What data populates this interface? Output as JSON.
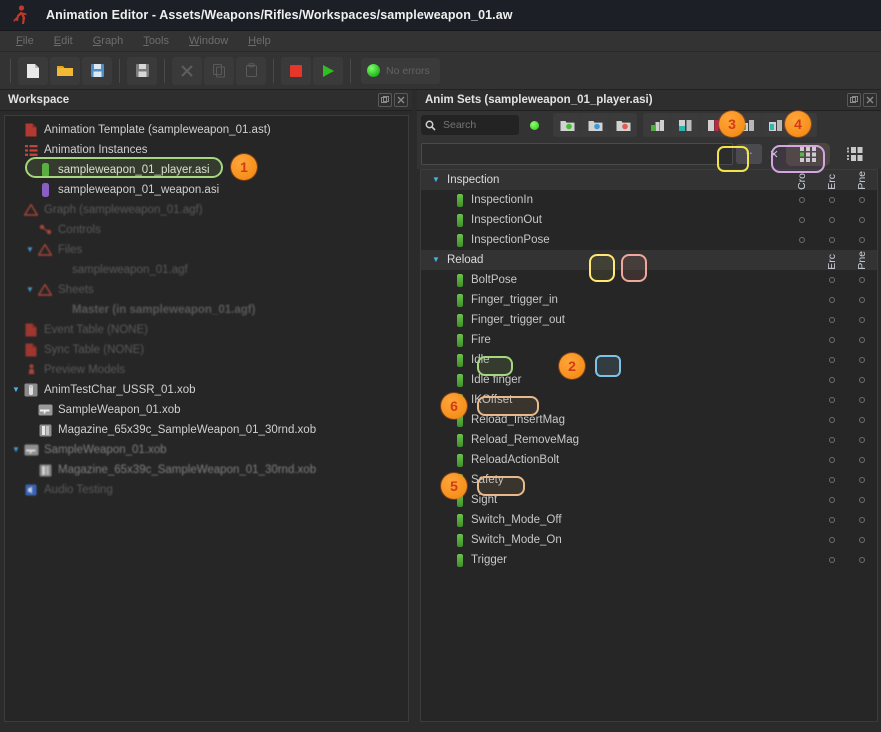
{
  "window": {
    "title": "Animation Editor - Assets/Weapons/Rifles/Workspaces/sampleweapon_01.aw",
    "icon": "running-man-icon"
  },
  "menubar": [
    {
      "label": "File",
      "mnemonic": "F"
    },
    {
      "label": "Edit",
      "mnemonic": "E"
    },
    {
      "label": "Graph",
      "mnemonic": "G"
    },
    {
      "label": "Tools",
      "mnemonic": "T"
    },
    {
      "label": "Window",
      "mnemonic": "W"
    },
    {
      "label": "Help",
      "mnemonic": "H"
    }
  ],
  "toolbar": {
    "buttons": [
      {
        "name": "new-file-icon",
        "tip": "New"
      },
      {
        "name": "open-folder-icon",
        "tip": "Open"
      },
      {
        "name": "save-icon",
        "tip": "Save"
      },
      {
        "name": "save-as-icon",
        "tip": "Save As"
      },
      {
        "name": "cut-icon",
        "tip": "Cut"
      },
      {
        "name": "copy-icon",
        "tip": "Copy"
      },
      {
        "name": "paste-icon",
        "tip": "Paste"
      },
      {
        "name": "stop-icon",
        "tip": "Stop"
      },
      {
        "name": "play-icon",
        "tip": "Play"
      }
    ],
    "status_label": "No errors",
    "status_color": "#33c024"
  },
  "workspace": {
    "panel_title": "Workspace",
    "items": [
      {
        "label": "Animation Template (sampleweapon_01.ast)",
        "indent": 0,
        "icon": "document-red-icon",
        "caret": "none",
        "state": "normal"
      },
      {
        "label": "Animation Instances",
        "indent": 0,
        "icon": "list-red-icon",
        "caret": "none",
        "state": "normal"
      },
      {
        "label": "sampleweapon_01_player.asi",
        "indent": 1,
        "icon": "green-bar-icon",
        "caret": "none",
        "state": "selected"
      },
      {
        "label": "sampleweapon_01_weapon.asi",
        "indent": 1,
        "icon": "purple-bar-icon",
        "caret": "none",
        "state": "normal"
      },
      {
        "label": "Graph (sampleweapon_01.agf)",
        "indent": 0,
        "icon": "graph-red-icon",
        "caret": "none",
        "state": "dim"
      },
      {
        "label": "Controls",
        "indent": 1,
        "icon": "controls-red-icon",
        "caret": "none",
        "state": "dim"
      },
      {
        "label": "Files",
        "indent": 1,
        "icon": "graph-red-icon",
        "caret": "open",
        "state": "dim"
      },
      {
        "label": "sampleweapon_01.agf",
        "indent": 2,
        "icon": "none",
        "caret": "none",
        "state": "dim"
      },
      {
        "label": "Sheets",
        "indent": 1,
        "icon": "graph-red-icon",
        "caret": "open",
        "state": "dim"
      },
      {
        "label": "Master (in sampleweapon_01.agf)",
        "indent": 2,
        "icon": "none",
        "caret": "none",
        "state": "dim-bold"
      },
      {
        "label": "Event Table (NONE)",
        "indent": 0,
        "icon": "document-red-icon",
        "caret": "none",
        "state": "dim"
      },
      {
        "label": "Sync Table (NONE)",
        "indent": 0,
        "icon": "document-red-icon",
        "caret": "none",
        "state": "dim"
      },
      {
        "label": "Preview Models",
        "indent": 0,
        "icon": "model-red-icon",
        "caret": "none",
        "state": "dim"
      },
      {
        "label": "AnimTestChar_USSR_01.xob",
        "indent": 0,
        "icon": "character-icon",
        "caret": "open",
        "state": "normal"
      },
      {
        "label": "SampleWeapon_01.xob",
        "indent": 1,
        "icon": "weapon-icon",
        "caret": "none",
        "state": "normal"
      },
      {
        "label": "Magazine_65x39c_SampleWeapon_01_30rnd.xob",
        "indent": 1,
        "icon": "magazine-icon",
        "caret": "none",
        "state": "normal"
      },
      {
        "label": "SampleWeapon_01.xob",
        "indent": 0,
        "icon": "weapon-icon",
        "caret": "open",
        "state": "dim2"
      },
      {
        "label": "Magazine_65x39c_SampleWeapon_01_30rnd.xob",
        "indent": 1,
        "icon": "magazine-icon",
        "caret": "none",
        "state": "dim2"
      },
      {
        "label": "Audio Testing",
        "indent": 0,
        "icon": "audio-blue-icon",
        "caret": "none",
        "state": "dim"
      }
    ]
  },
  "animsets": {
    "panel_title": "Anim Sets (sampleweapon_01_player.asi)",
    "search_placeholder": "Search",
    "search_value": "",
    "filter_value": "",
    "dots_label": "..",
    "close_label": "×",
    "columns": [
      "Cro",
      "Erc",
      "Pne"
    ],
    "tree": [
      {
        "label": "Inspection",
        "type": "group",
        "cells": 0,
        "headers": true
      },
      {
        "label": "InspectionIn",
        "type": "item",
        "cells": 3
      },
      {
        "label": "InspectionOut",
        "type": "item",
        "cells": 3
      },
      {
        "label": "InspectionPose",
        "type": "item",
        "cells": 3
      },
      {
        "label": "Reload",
        "type": "group",
        "cells": 0,
        "headers_partial": [
          "Erc",
          "Pne"
        ]
      },
      {
        "label": "BoltPose",
        "type": "item",
        "cells": 2
      },
      {
        "label": "Finger_trigger_in",
        "type": "item",
        "cells": 2
      },
      {
        "label": "Finger_trigger_out",
        "type": "item",
        "cells": 2
      },
      {
        "label": "Fire",
        "type": "item",
        "cells": 2
      },
      {
        "label": "Idle",
        "type": "item",
        "cells": 2
      },
      {
        "label": "Idle finger",
        "type": "item",
        "cells": 2
      },
      {
        "label": "IKOffset",
        "type": "item",
        "cells": 2
      },
      {
        "label": "Reload_InsertMag",
        "type": "item",
        "cells": 2
      },
      {
        "label": "Reload_RemoveMag",
        "type": "item",
        "cells": 2
      },
      {
        "label": "ReloadActionBolt",
        "type": "item",
        "cells": 2
      },
      {
        "label": "Safety",
        "type": "item",
        "cells": 2
      },
      {
        "label": "Sight",
        "type": "item",
        "cells": 2
      },
      {
        "label": "Switch_Mode_Off",
        "type": "item",
        "cells": 2
      },
      {
        "label": "Switch_Mode_On",
        "type": "item",
        "cells": 2
      },
      {
        "label": "Trigger",
        "type": "item",
        "cells": 2
      }
    ]
  },
  "annotations": {
    "badges": [
      {
        "number": "1",
        "target": "sampleweapon_01_player.asi"
      },
      {
        "number": "2",
        "target": "Idle-Cro-cell"
      },
      {
        "number": "3",
        "target": "animset-toolbar-button-3"
      },
      {
        "number": "4",
        "target": "animset-view-toggle"
      },
      {
        "number": "5",
        "target": "Safety"
      },
      {
        "number": "6",
        "target": "IKOffset"
      }
    ]
  }
}
